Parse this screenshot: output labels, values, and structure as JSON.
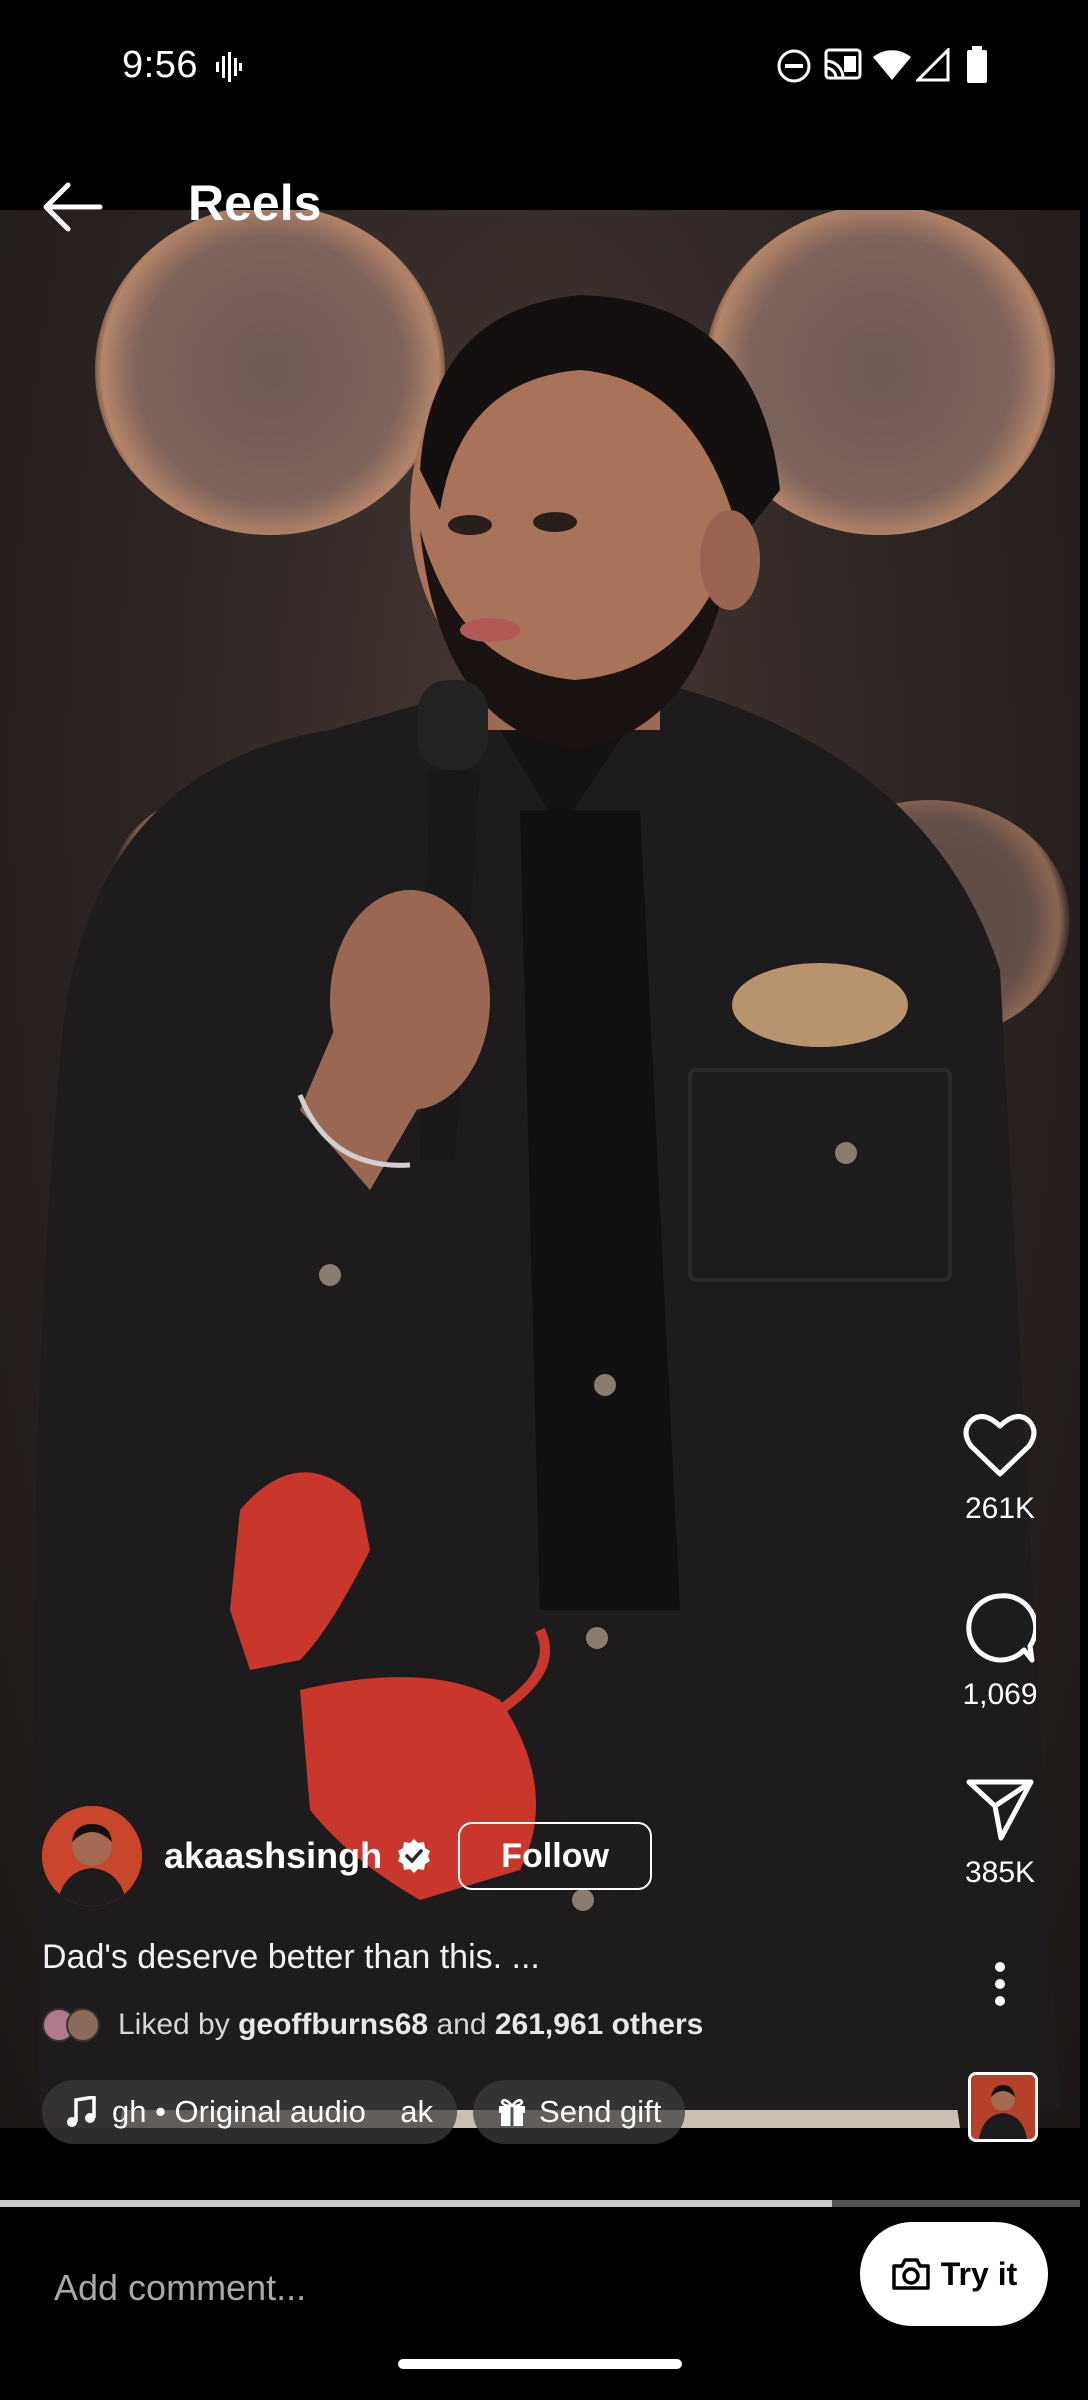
{
  "status_bar": {
    "time": "9:56"
  },
  "header": {
    "title": "Reels"
  },
  "reel": {
    "author": {
      "username": "akaashsingh",
      "verified": true,
      "follow_label": "Follow"
    },
    "caption": "Dad's deserve better than this. ...",
    "liked_by": {
      "prefix": "Liked by",
      "user": "geoffburns68",
      "middle": "and",
      "others": "261,961 others"
    },
    "audio_chip": "gh • Original audio    ak",
    "gift_chip": "Send gift",
    "progress": 0.77
  },
  "actions": {
    "likes": "261K",
    "comments": "1,069",
    "shares": "385K"
  },
  "comment_bar": {
    "placeholder": "Add comment...",
    "try_label": "Try it"
  },
  "colors": {
    "accent": "#ffffff",
    "background": "#000000",
    "jacket_tiger": "#c8362c"
  }
}
